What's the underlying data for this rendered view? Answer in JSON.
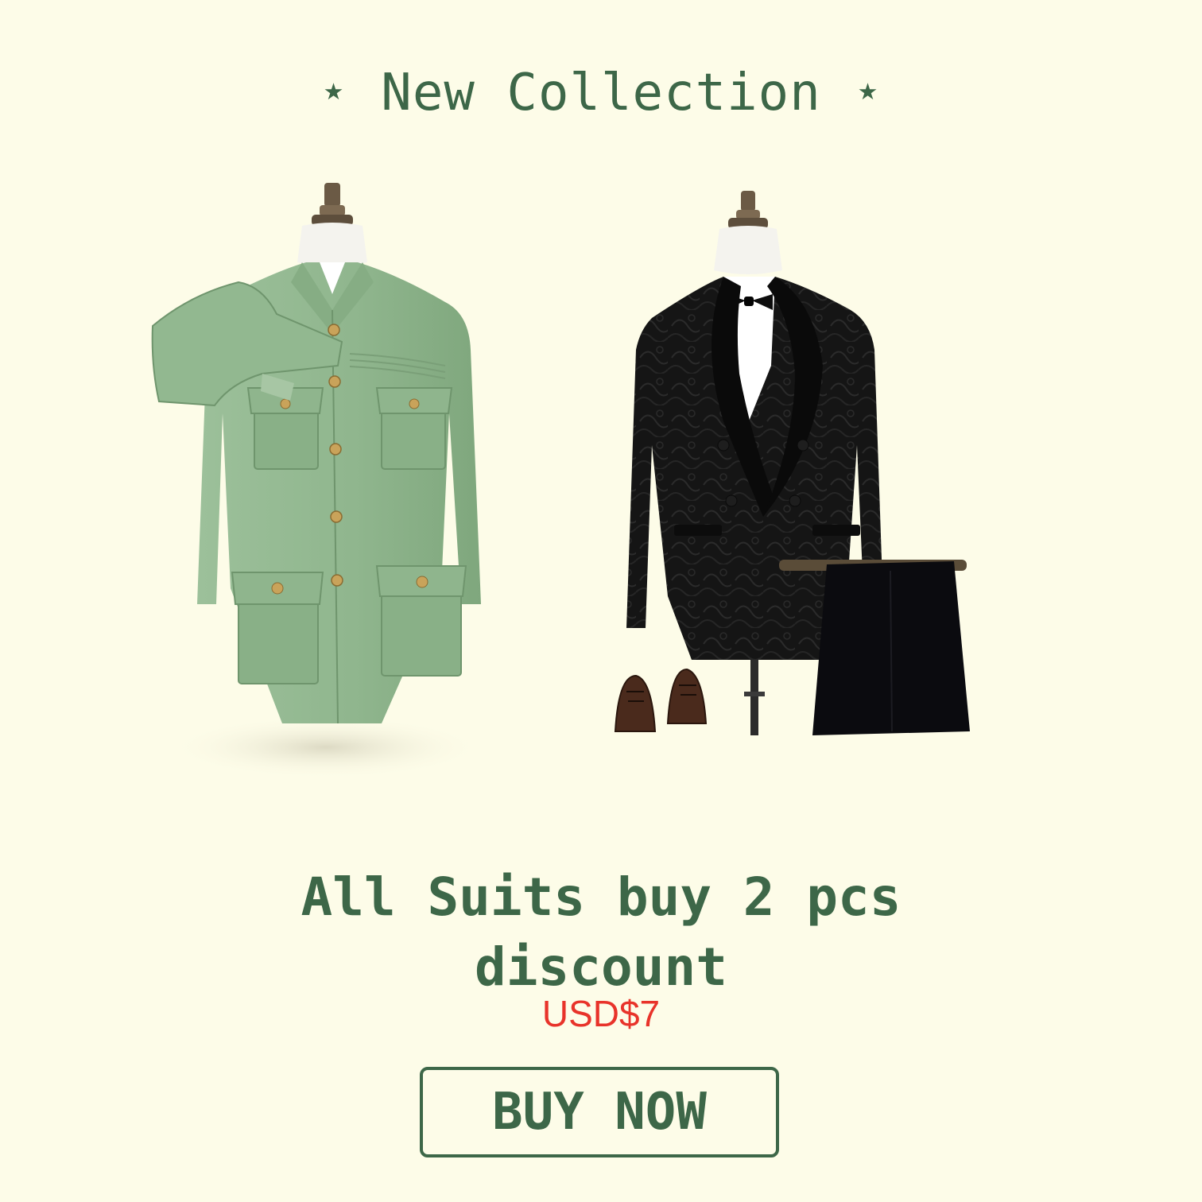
{
  "header": {
    "title": "⋆ New Collection ⋆"
  },
  "products": [
    {
      "id": "green-safari-suit",
      "color": "#8fb58d"
    },
    {
      "id": "black-jacquard-tuxedo",
      "color": "#151515"
    }
  ],
  "promo": {
    "line1": "All Suits buy 2 pcs",
    "line2": "discount",
    "price": "USD$7"
  },
  "cta": {
    "label": "BUY NOW"
  },
  "colors": {
    "background": "#fdfce8",
    "brand_green": "#3d6748",
    "price_red": "#e8332a"
  }
}
